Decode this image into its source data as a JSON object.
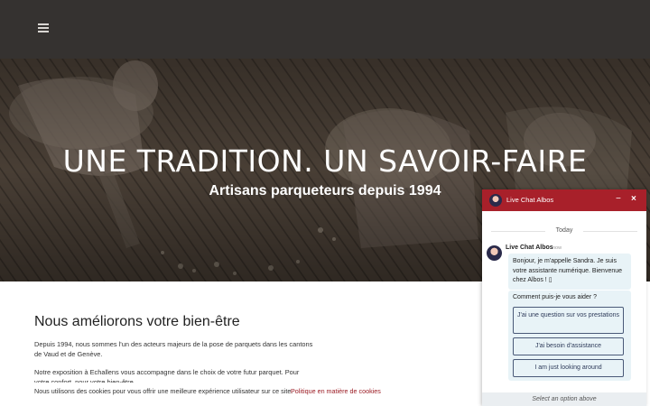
{
  "header": {
    "menu_icon": "hamburger-menu-icon"
  },
  "hero": {
    "title": "UNE TRADITION. UN SAVOIR-FAIRE",
    "subtitle": "Artisans parqueteurs depuis 1994"
  },
  "content": {
    "heading": "Nous améliorons votre bien-être",
    "paragraph1": "Depuis 1994, nous sommes l'un des acteurs majeurs de la pose de parquets dans les cantons de Vaud et de Genève.",
    "paragraph2": "Notre exposition à Echallens vous accompagne dans le choix de votre futur parquet. Pour votre confort, pour votre bien-être."
  },
  "cookie": {
    "text": "Nous utilisons des cookies pour vous offrir une meilleure expérience utilisateur sur ce site.",
    "link": "Politique en matière de cookies"
  },
  "chat": {
    "title": "Live Chat Albos",
    "minimize": "−",
    "close": "×",
    "date_divider": "Today",
    "agent_name": "Live Chat Albos",
    "time": "now",
    "message": "Bonjour, je m'appelle Sandra. Je suis votre assistante numérique. Bienvenue chez Albos ! ▯",
    "question": "Comment puis-je vous aider ?",
    "options": [
      "J'ai une question sur vos prestations",
      "J'ai besoin d'assistance",
      "I am just looking around"
    ],
    "footer": "Select an option above",
    "colors": {
      "header": "#a8202a",
      "bubble": "#e8f3f7",
      "option_border": "#4a5a78"
    }
  }
}
